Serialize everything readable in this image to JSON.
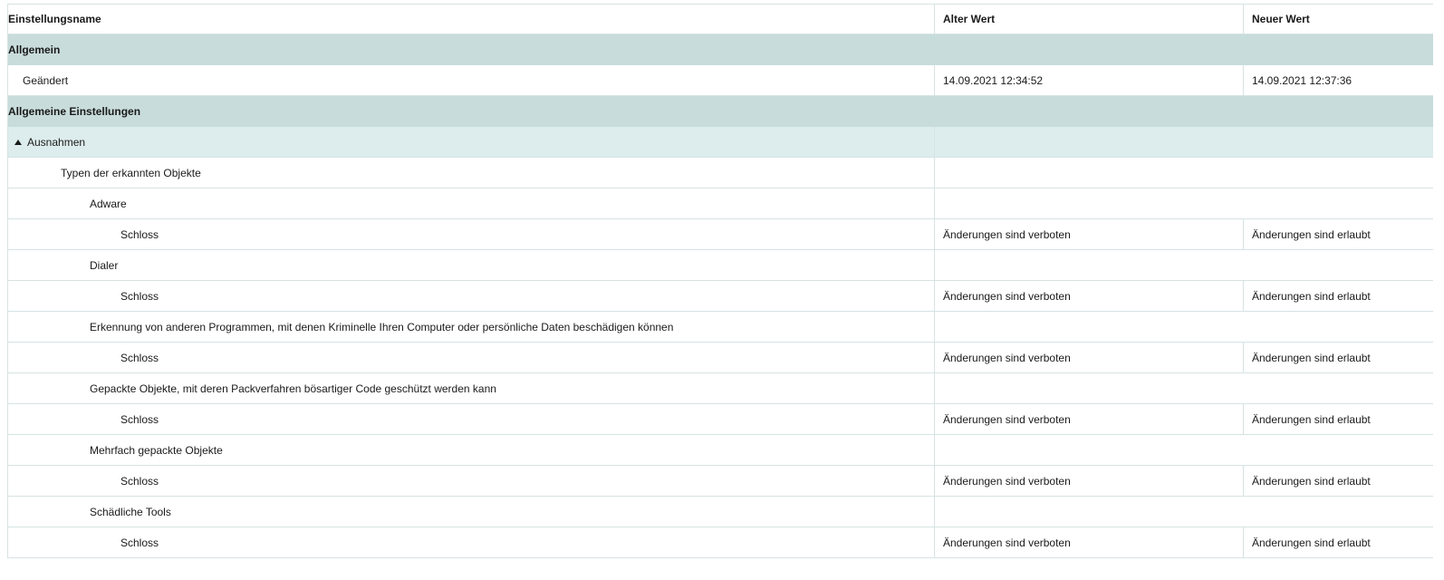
{
  "table": {
    "headers": {
      "name": "Einstellungsname",
      "old": "Alter Wert",
      "new": "Neuer Wert"
    },
    "section_general": {
      "label": "Allgemein",
      "changed_label": "Geändert",
      "changed_old": "14.09.2021 12:34:52",
      "changed_new": "14.09.2021 12:37:36"
    },
    "section_settings": {
      "label": "Allgemeine Einstellungen",
      "exceptions_label": "Ausnahmen",
      "detected_types_label": "Typen der erkannten Objekte",
      "groups": [
        {
          "label": "Adware",
          "lock_label": "Schloss",
          "old": "Änderungen sind verboten",
          "new": "Änderungen sind erlaubt"
        },
        {
          "label": "Dialer",
          "lock_label": "Schloss",
          "old": "Änderungen sind verboten",
          "new": "Änderungen sind erlaubt"
        },
        {
          "label": "Erkennung von anderen Programmen, mit denen Kriminelle Ihren Computer oder persönliche Daten beschädigen können",
          "lock_label": "Schloss",
          "old": "Änderungen sind verboten",
          "new": "Änderungen sind erlaubt"
        },
        {
          "label": "Gepackte Objekte, mit deren Packverfahren bösartiger Code geschützt werden kann",
          "lock_label": "Schloss",
          "old": "Änderungen sind verboten",
          "new": "Änderungen sind erlaubt"
        },
        {
          "label": "Mehrfach gepackte Objekte",
          "lock_label": "Schloss",
          "old": "Änderungen sind verboten",
          "new": "Änderungen sind erlaubt"
        },
        {
          "label": "Schädliche Tools",
          "lock_label": "Schloss",
          "old": "Änderungen sind verboten",
          "new": "Änderungen sind erlaubt"
        }
      ]
    }
  },
  "icons": {
    "collapse": "triangle-up-icon"
  }
}
